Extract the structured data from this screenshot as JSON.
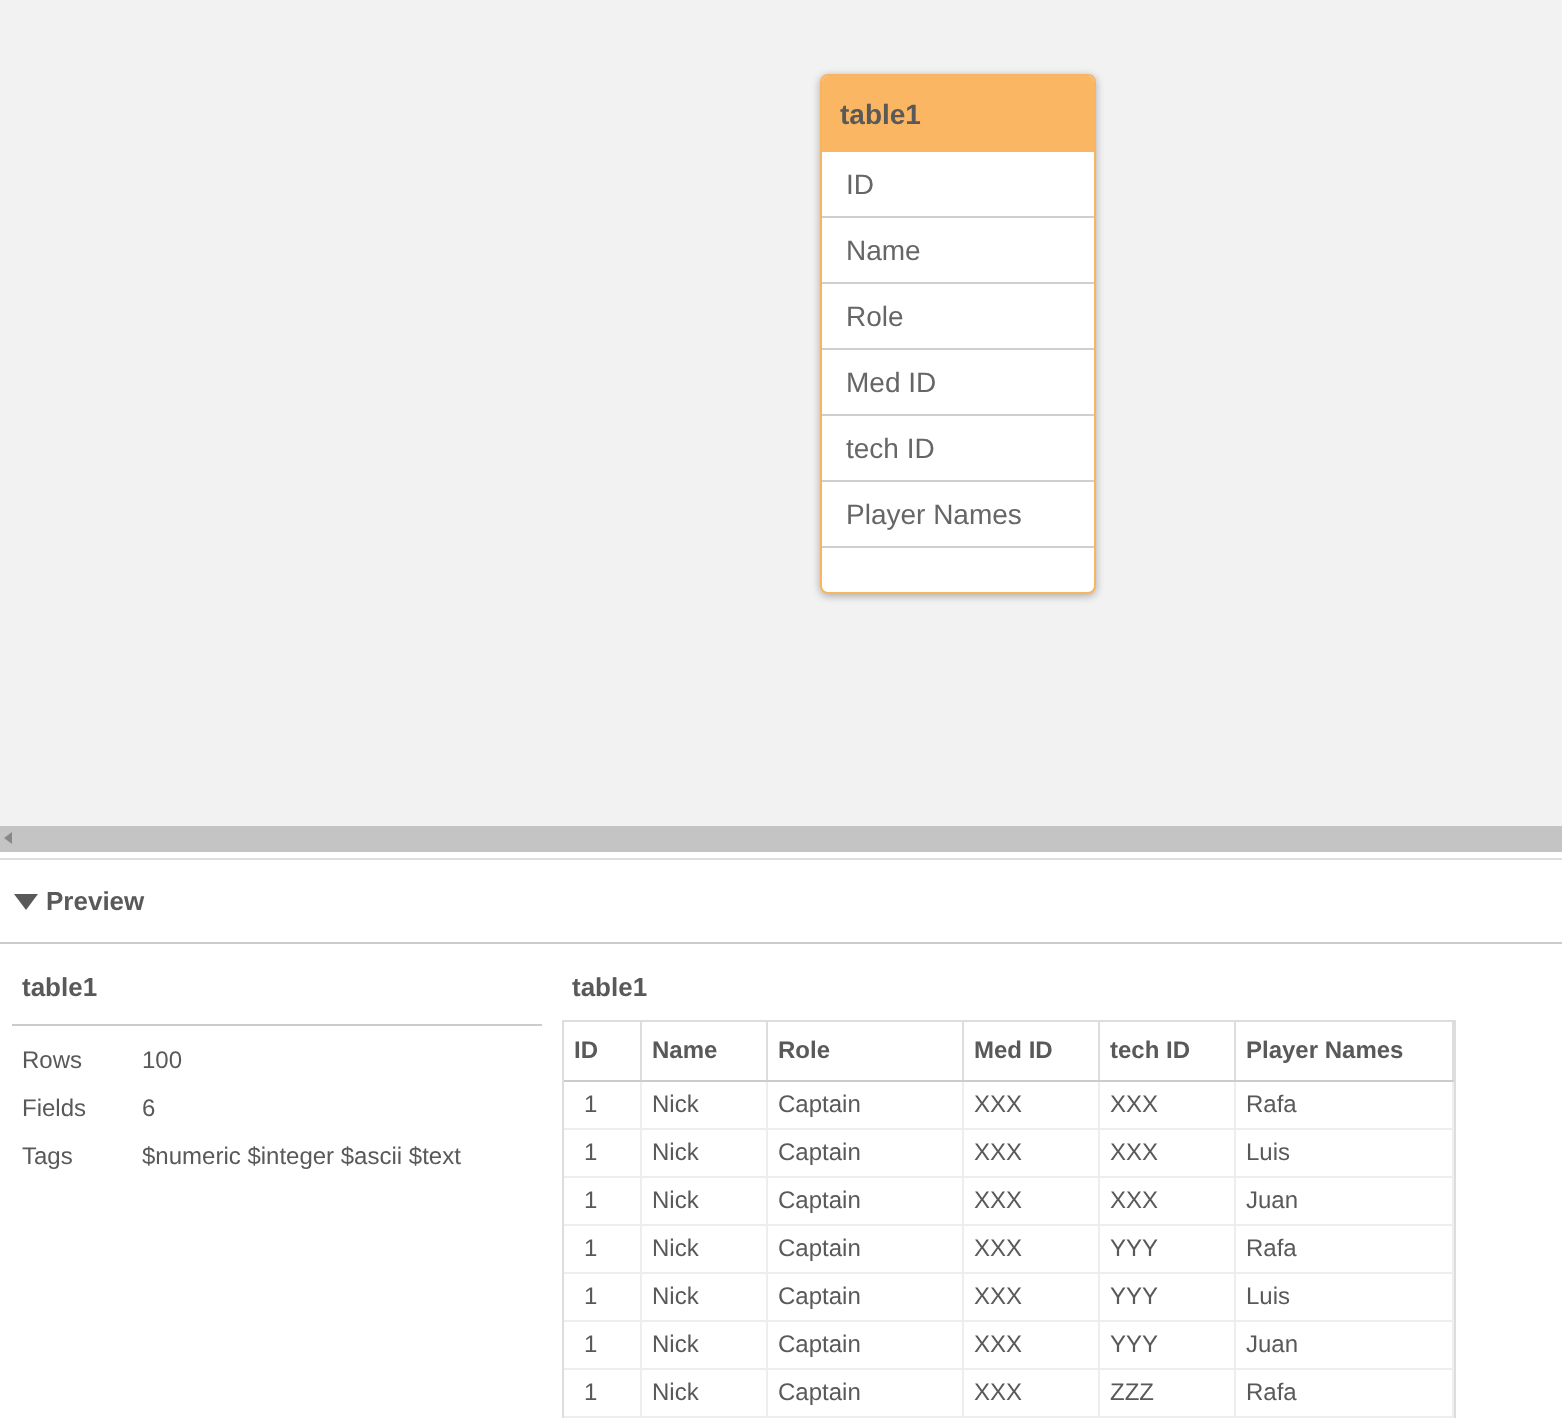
{
  "canvas": {
    "table_node": {
      "title": "table1",
      "fields": [
        "ID",
        "Name",
        "Role",
        "Med ID",
        "tech ID",
        "Player Names"
      ]
    }
  },
  "preview": {
    "title": "Preview",
    "expanded": true,
    "summary": {
      "title": "table1",
      "stats": [
        {
          "label": "Rows",
          "value": "100"
        },
        {
          "label": "Fields",
          "value": "6"
        },
        {
          "label": "Tags",
          "value": "$numeric $integer $ascii $text"
        }
      ]
    },
    "table": {
      "title": "table1",
      "columns": [
        "ID",
        "Name",
        "Role",
        "Med ID",
        "tech ID",
        "Player Names"
      ],
      "rows": [
        [
          "1",
          "Nick",
          "Captain",
          "XXX",
          "XXX",
          "Rafa"
        ],
        [
          "1",
          "Nick",
          "Captain",
          "XXX",
          "XXX",
          "Luis"
        ],
        [
          "1",
          "Nick",
          "Captain",
          "XXX",
          "XXX",
          "Juan"
        ],
        [
          "1",
          "Nick",
          "Captain",
          "XXX",
          "YYY",
          "Rafa"
        ],
        [
          "1",
          "Nick",
          "Captain",
          "XXX",
          "YYY",
          "Luis"
        ],
        [
          "1",
          "Nick",
          "Captain",
          "XXX",
          "YYY",
          "Juan"
        ],
        [
          "1",
          "Nick",
          "Captain",
          "XXX",
          "ZZZ",
          "Rafa"
        ]
      ]
    }
  }
}
